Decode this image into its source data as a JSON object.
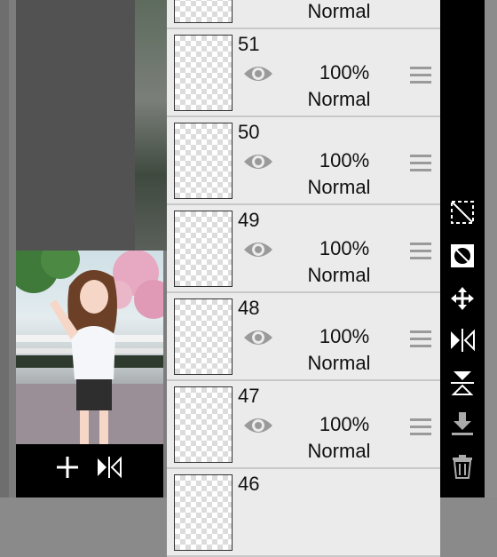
{
  "layers": [
    {
      "number": "",
      "opacity": "",
      "blend": "Normal"
    },
    {
      "number": "51",
      "opacity": "100%",
      "blend": "Normal"
    },
    {
      "number": "50",
      "opacity": "100%",
      "blend": "Normal"
    },
    {
      "number": "49",
      "opacity": "100%",
      "blend": "Normal"
    },
    {
      "number": "48",
      "opacity": "100%",
      "blend": "Normal"
    },
    {
      "number": "47",
      "opacity": "100%",
      "blend": "Normal"
    },
    {
      "number": "46",
      "opacity": "",
      "blend": ""
    }
  ],
  "preview_toolbar": {
    "add_icon": "plus-icon",
    "flip_icon": "flip-horizontal-icon"
  },
  "right_toolbar": [
    "selection-clear-icon",
    "selection-invert-icon",
    "move-icon",
    "flip-horizontal-icon",
    "flip-vertical-icon",
    "merge-down-icon",
    "trash-icon"
  ]
}
